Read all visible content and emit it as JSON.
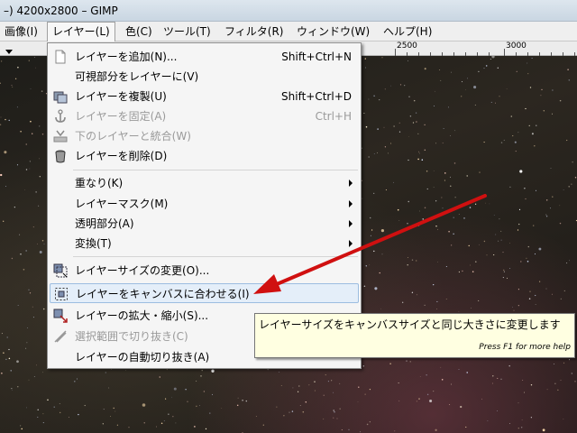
{
  "window": {
    "title": "–) 4200x2800 – GIMP"
  },
  "menubar": {
    "items": [
      {
        "label": "画像(I)"
      },
      {
        "label": "レイヤー(L)"
      },
      {
        "label": "色(C)"
      },
      {
        "label": "ツール(T)"
      },
      {
        "label": "フィルタ(R)"
      },
      {
        "label": "ウィンドウ(W)"
      },
      {
        "label": "ヘルプ(H)"
      }
    ]
  },
  "ruler": {
    "labels": [
      "2500",
      "3000"
    ]
  },
  "layer_menu": {
    "items": [
      {
        "label": "レイヤーを追加(N)...",
        "shortcut": "Shift+Ctrl+N",
        "icon": "new-layer-icon",
        "enabled": true
      },
      {
        "label": "可視部分をレイヤーに(V)",
        "shortcut": "",
        "icon": "",
        "enabled": true
      },
      {
        "label": "レイヤーを複製(U)",
        "shortcut": "Shift+Ctrl+D",
        "icon": "duplicate-layer-icon",
        "enabled": true
      },
      {
        "label": "レイヤーを固定(A)",
        "shortcut": "Ctrl+H",
        "icon": "anchor-icon",
        "enabled": false
      },
      {
        "label": "下のレイヤーと統合(W)",
        "shortcut": "",
        "icon": "merge-down-icon",
        "enabled": false
      },
      {
        "label": "レイヤーを削除(D)",
        "shortcut": "",
        "icon": "trash-icon",
        "enabled": true
      },
      {
        "label": "重なり(K)",
        "submenu": true,
        "enabled": true
      },
      {
        "label": "レイヤーマスク(M)",
        "submenu": true,
        "enabled": true
      },
      {
        "label": "透明部分(A)",
        "submenu": true,
        "enabled": true
      },
      {
        "label": "変換(T)",
        "submenu": true,
        "enabled": true
      },
      {
        "label": "レイヤーサイズの変更(O)...",
        "icon": "layer-boundary-size-icon",
        "enabled": true
      },
      {
        "label": "レイヤーをキャンバスに合わせる(I)",
        "icon": "layer-to-canvas-icon",
        "enabled": true,
        "highlighted": true
      },
      {
        "label": "レイヤーの拡大・縮小(S)...",
        "icon": "scale-layer-icon",
        "enabled": true
      },
      {
        "label": "選択範囲で切り抜き(C)",
        "icon": "crop-to-selection-icon",
        "enabled": false
      },
      {
        "label": "レイヤーの自動切り抜き(A)",
        "icon": "",
        "enabled": true
      }
    ]
  },
  "tooltip": {
    "text": "レイヤーサイズをキャンバスサイズと同じ大きさに変更します",
    "help": "Press F1 for more help"
  },
  "colors": {
    "annotation_arrow": "#d01010",
    "highlight": "#e4eef9",
    "tooltip_bg": "#ffffe1"
  }
}
